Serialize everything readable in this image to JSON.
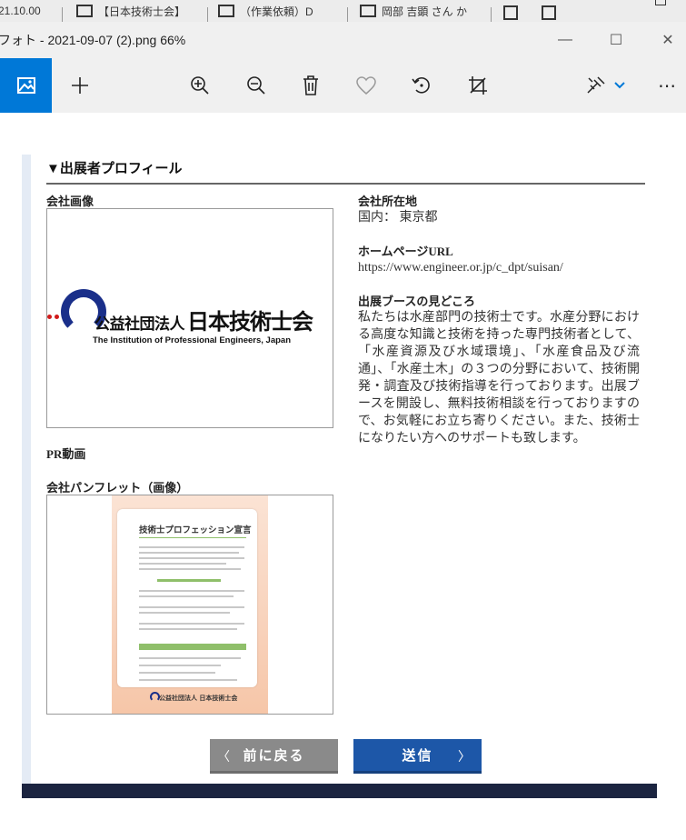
{
  "taskbar": {
    "tabs": [
      {
        "label": "(21.10.00"
      },
      {
        "label": "【日本技術士会】"
      },
      {
        "label": "（作業依頼）D"
      },
      {
        "label": "岡部 吉顕 さん か"
      }
    ]
  },
  "window": {
    "title": "フォト - 2021-09-07 (2).png   66%",
    "minimize": "—",
    "maximize": "☐",
    "close": "✕"
  },
  "toolbar": {
    "more_label": "⋯"
  },
  "profile": {
    "section_title": "▼出展者プロフィール",
    "company_image_label": "会社画像",
    "logo": {
      "jp_small": "公益社団法人",
      "jp_large": "日本技術士会",
      "en": "The Institution of Professional Engineers, Japan"
    },
    "location_label": "会社所在地",
    "location_value": "国内： 東京都",
    "homepage_label": "ホームページURL",
    "homepage_value": "https://www.engineer.or.jp/c_dpt/suisan/",
    "booth_label": "出展ブースの見どころ",
    "booth_text": "私たちは水産部門の技術士です。水産分野における高度な知識と技術を持った専門技術者として、「水産資源及び水域環境」、「水産食品及び流通」、「水産土木」の３つの分野において、技術開発・調査及び技術指導を行っております。出展ブースを開設し、無料技術相談を行っておりますので、お気軽にお立ち寄りください。また、技術士になりたい方へのサポートも致します。",
    "pr_video_label": "PR動画",
    "pamphlet_label": "会社パンフレット（画像）",
    "pamphlet": {
      "title": "技術士プロフェッション宣言",
      "footer": "公益社団法人 日本技術士会"
    }
  },
  "buttons": {
    "back_label": "前に戻る",
    "back_chevron": "〈",
    "send_label": "送信",
    "send_chevron": "〉"
  },
  "colors": {
    "accent": "#0078d7",
    "send_button": "#1d57a8",
    "back_button": "#8a8a8a",
    "footer_band": "#1b2440"
  }
}
